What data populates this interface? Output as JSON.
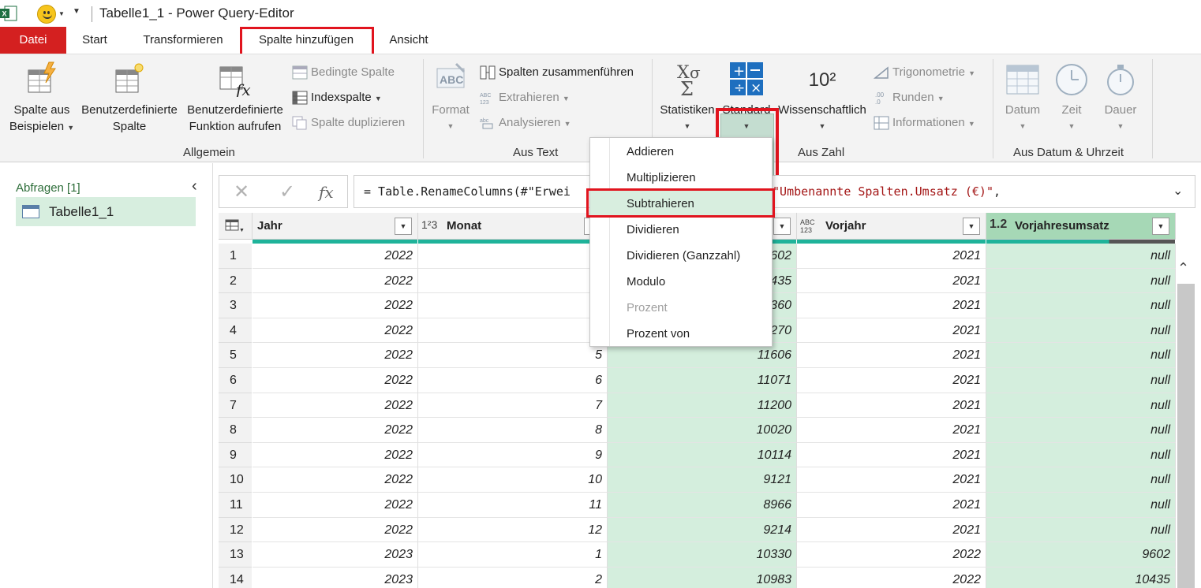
{
  "window": {
    "title": "Tabelle1_1 - Power Query-Editor"
  },
  "tabs": {
    "file": "Datei",
    "start": "Start",
    "transform": "Transformieren",
    "add_column": "Spalte hinzufügen",
    "view": "Ansicht"
  },
  "ribbon": {
    "general": {
      "label": "Allgemein",
      "column_from_examples": [
        "Spalte aus",
        "Beispielen"
      ],
      "custom_column": [
        "Benutzerdefinierte",
        "Spalte"
      ],
      "invoke_custom_function": [
        "Benutzerdefinierte",
        "Funktion aufrufen"
      ],
      "conditional_column": "Bedingte Spalte",
      "index_column": "Indexspalte",
      "duplicate_column": "Spalte duplizieren"
    },
    "from_text": {
      "label": "Aus Text",
      "format": "Format",
      "format_icon": "ABC",
      "merge_columns": "Spalten zusammenführen",
      "extract": "Extrahieren",
      "parse": "Analysieren"
    },
    "from_number": {
      "label": "Aus Zahl",
      "statistics": "Statistiken",
      "standard": "Standard",
      "scientific": "Wissenschaftlich",
      "scientific_icon": "10²",
      "trigonometry": "Trigonometrie",
      "rounding": "Runden",
      "information": "Informationen"
    },
    "from_datetime": {
      "label": "Aus Datum & Uhrzeit",
      "date": "Datum",
      "time": "Zeit",
      "duration": "Dauer"
    }
  },
  "queries": {
    "header": "Abfragen [1]",
    "items": [
      {
        "label": "Tabelle1_1"
      }
    ]
  },
  "formula_bar": {
    "prefix": "= Table.RenameColumns(#\"Erwei",
    "middle": "\",{{",
    "string": "\"Umbenannte Spalten.Umsatz (€)\"",
    "suffix": ","
  },
  "grid": {
    "columns": [
      {
        "name": "Jahr",
        "type_icon": ""
      },
      {
        "name": "Monat",
        "type_icon": "1²3"
      },
      {
        "name": "",
        "type_icon": ""
      },
      {
        "name": "Vorjahr",
        "type_icon": "ABC 123"
      },
      {
        "name": "Vorjahresumsatz",
        "type_icon": "1.2"
      }
    ],
    "rows": [
      [
        "1",
        "2022",
        "",
        "9602",
        "2021",
        "null"
      ],
      [
        "2",
        "2022",
        "",
        "10435",
        "2021",
        "null"
      ],
      [
        "3",
        "2022",
        "",
        "10360",
        "2021",
        "null"
      ],
      [
        "4",
        "2022",
        "",
        "10270",
        "2021",
        "null"
      ],
      [
        "5",
        "2022",
        "5",
        "11606",
        "2021",
        "null"
      ],
      [
        "6",
        "2022",
        "6",
        "11071",
        "2021",
        "null"
      ],
      [
        "7",
        "2022",
        "7",
        "11200",
        "2021",
        "null"
      ],
      [
        "8",
        "2022",
        "8",
        "10020",
        "2021",
        "null"
      ],
      [
        "9",
        "2022",
        "9",
        "10114",
        "2021",
        "null"
      ],
      [
        "10",
        "2022",
        "10",
        "9121",
        "2021",
        "null"
      ],
      [
        "11",
        "2022",
        "11",
        "8966",
        "2021",
        "null"
      ],
      [
        "12",
        "2022",
        "12",
        "9214",
        "2021",
        "null"
      ],
      [
        "13",
        "2023",
        "1",
        "10330",
        "2022",
        "9602"
      ],
      [
        "14",
        "2023",
        "2",
        "10983",
        "2022",
        "10435"
      ]
    ]
  },
  "menu": {
    "items": [
      {
        "label": "Addieren",
        "enabled": true
      },
      {
        "label": "Multiplizieren",
        "enabled": true
      },
      {
        "label": "Subtrahieren",
        "enabled": true,
        "highlighted": true
      },
      {
        "label": "Dividieren",
        "enabled": true
      },
      {
        "label": "Dividieren (Ganzzahl)",
        "enabled": true
      },
      {
        "label": "Modulo",
        "enabled": true
      },
      {
        "label": "Prozent",
        "enabled": false
      },
      {
        "label": "Prozent von",
        "enabled": true
      }
    ]
  },
  "colors": {
    "file_tab": "#d42020",
    "highlight_red": "#e1141e",
    "selected_green": "#d4eedd",
    "column_bar": "#1fb39a"
  }
}
